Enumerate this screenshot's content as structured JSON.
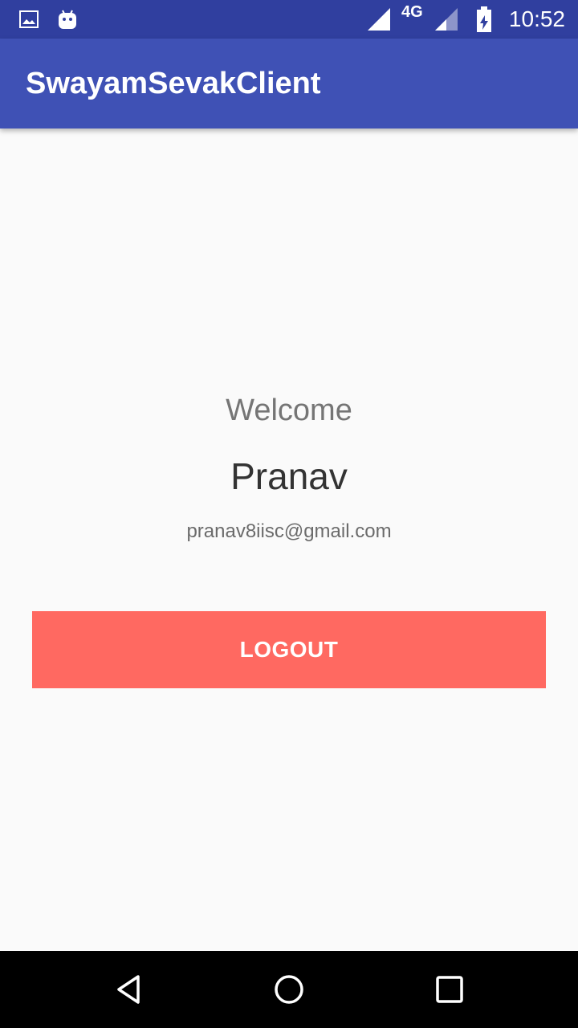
{
  "status_bar": {
    "network": "4G",
    "time": "10:52",
    "icons": [
      "image-icon",
      "android-icon",
      "signal-icon",
      "signal-weak-icon",
      "battery-charging-icon"
    ]
  },
  "app_bar": {
    "title": "SwayamSevakClient"
  },
  "profile": {
    "greeting": "Welcome",
    "name": "Pranav",
    "email": "pranav8iisc@gmail.com"
  },
  "actions": {
    "logout_label": "LOGOUT"
  },
  "nav_bar": {
    "icons": [
      "back-icon",
      "home-icon",
      "recents-icon"
    ]
  },
  "colors": {
    "status_bar": "#303f9f",
    "app_bar": "#3f51b5",
    "logout_button": "#ff6961",
    "background": "#fafafa"
  }
}
